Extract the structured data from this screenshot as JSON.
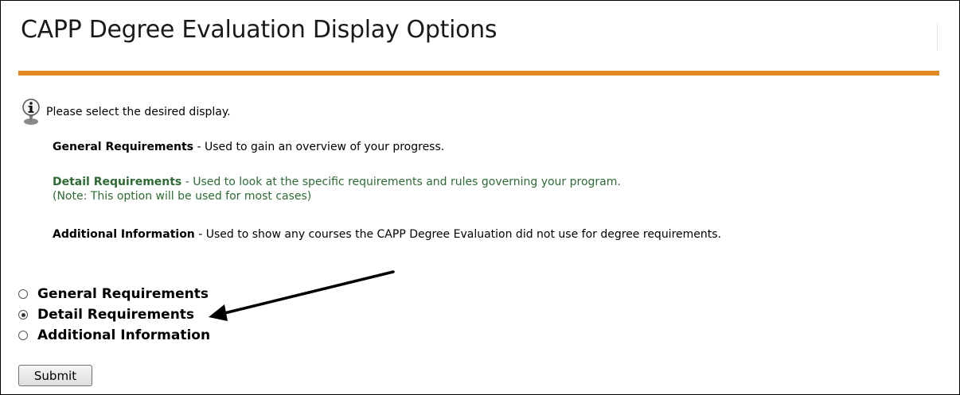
{
  "page": {
    "title": "CAPP Degree Evaluation Display Options",
    "accent_color": "#e0891f"
  },
  "info": {
    "icon": "info-icon",
    "text": "Please select the desired display."
  },
  "descriptions": [
    {
      "label": "General Requirements",
      "text": " - Used to gain an overview of your progress.",
      "color": "#000000"
    },
    {
      "label": "Detail Requirements",
      "text": " - Used to look at the specific requirements and rules governing your program.",
      "note": "(Note: This option will be used for most cases)",
      "color": "#2e6b34"
    },
    {
      "label": "Additional Information",
      "text": " - Used to show any courses the CAPP Degree Evaluation did not use for degree requirements.",
      "color": "#000000"
    }
  ],
  "options": [
    {
      "label": "General Requirements",
      "selected": false
    },
    {
      "label": "Detail Requirements",
      "selected": true
    },
    {
      "label": "Additional Information",
      "selected": false
    }
  ],
  "submit_label": "Submit"
}
